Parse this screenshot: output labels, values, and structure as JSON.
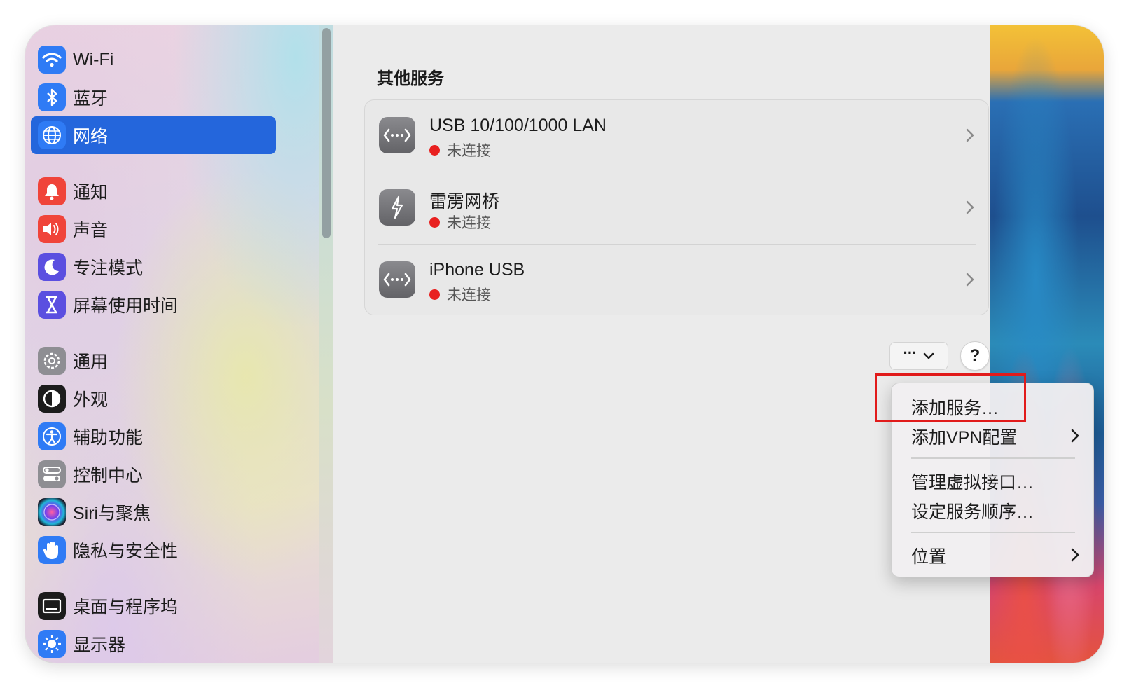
{
  "sidebar": {
    "items": [
      {
        "label": "Wi-Fi",
        "icon": "wifi-icon",
        "color": "#2f7bf5"
      },
      {
        "label": "蓝牙",
        "icon": "bluetooth-icon",
        "color": "#2f7bf5"
      },
      {
        "label": "网络",
        "icon": "globe-icon",
        "color": "#2f7bf5",
        "selected": true
      },
      {
        "label": "通知",
        "icon": "bell-icon",
        "color": "#f0443a"
      },
      {
        "label": "声音",
        "icon": "speaker-icon",
        "color": "#f0443a"
      },
      {
        "label": "专注模式",
        "icon": "moon-icon",
        "color": "#5b4fe0"
      },
      {
        "label": "屏幕使用时间",
        "icon": "hourglass-icon",
        "color": "#5b4fe0"
      },
      {
        "label": "通用",
        "icon": "gear-icon",
        "color": "#8e8e93"
      },
      {
        "label": "外观",
        "icon": "appearance-icon",
        "color": "#1c1c1c"
      },
      {
        "label": "辅助功能",
        "icon": "accessibility-icon",
        "color": "#2f7bf5"
      },
      {
        "label": "控制中心",
        "icon": "control-center-icon",
        "color": "#8e8e93"
      },
      {
        "label": "Siri与聚焦",
        "icon": "siri-icon",
        "color": "#3a2a5a"
      },
      {
        "label": "隐私与安全性",
        "icon": "hand-icon",
        "color": "#2f7bf5"
      },
      {
        "label": "桌面与程序坞",
        "icon": "dock-icon",
        "color": "#1c1c1c"
      },
      {
        "label": "显示器",
        "icon": "sun-icon",
        "color": "#2f7bf5"
      }
    ]
  },
  "main": {
    "section_title": "其他服务",
    "services": [
      {
        "name": "USB 10/100/1000 LAN",
        "status": "未连接",
        "icon": "ethernet-icon"
      },
      {
        "name": "雷雳网桥",
        "status": "未连接",
        "icon": "thunderbolt-icon"
      },
      {
        "name": "iPhone USB",
        "status": "未连接",
        "icon": "ethernet-icon"
      }
    ],
    "action_button": "···",
    "help_button": "?"
  },
  "menu": {
    "items": [
      {
        "label": "添加服务…",
        "has_submenu": false
      },
      {
        "label": "添加VPN配置",
        "has_submenu": true
      },
      {
        "label": "管理虚拟接口…",
        "has_submenu": false
      },
      {
        "label": "设定服务顺序…",
        "has_submenu": false
      },
      {
        "label": "位置",
        "has_submenu": true
      }
    ]
  },
  "colors": {
    "selection": "#2466dc",
    "status_disconnected": "#e8201f",
    "highlight_box": "#e11b1b"
  }
}
